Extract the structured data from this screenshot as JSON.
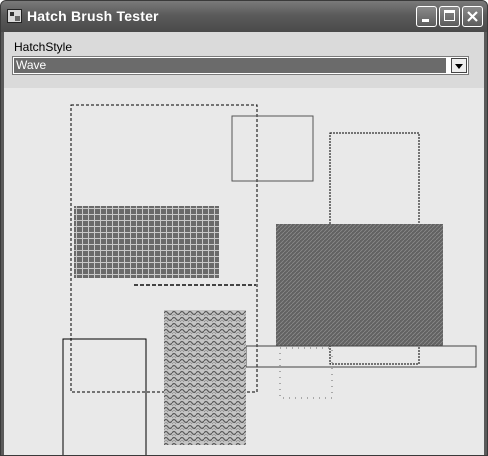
{
  "window": {
    "title": "Hatch Brush Tester"
  },
  "form": {
    "label": "HatchStyle",
    "combo_value": "Wave",
    "combo_options_visible": [
      "Wave"
    ]
  },
  "colors": {
    "titlebar": "#5b5b5b",
    "client": "#e9e9e9",
    "panel": "#dadada",
    "selection": "#6b6b6b"
  },
  "icons": [
    "app-window-icon",
    "minimize-icon",
    "maximize-icon",
    "close-icon",
    "chevron-down-icon"
  ]
}
